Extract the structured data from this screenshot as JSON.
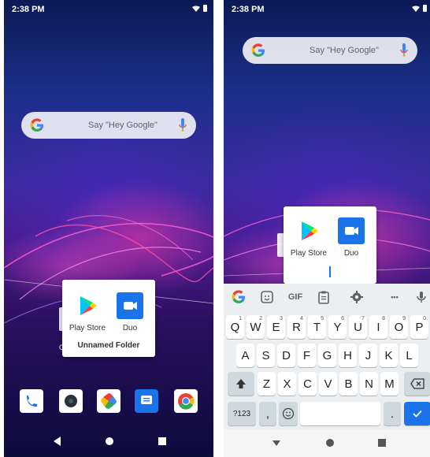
{
  "left_screen": {
    "status_time": "2:38 PM",
    "search_hint": "Say \"Hey Google\"",
    "folder": {
      "apps": [
        {
          "label": "Play Store"
        },
        {
          "label": "Duo"
        }
      ],
      "name": "Unnamed Folder"
    },
    "behind_label": "G",
    "dock_icons": [
      "phone-icon",
      "camera-icon",
      "photos-icon",
      "messages-icon",
      "chrome-icon"
    ]
  },
  "right_screen": {
    "status_time": "2:38 PM",
    "search_hint": "Say \"Hey Google\"",
    "folder": {
      "apps": [
        {
          "label": "Play Store"
        },
        {
          "label": "Duo"
        }
      ]
    },
    "keyboard": {
      "toolbar": {
        "gif_label": "GIF",
        "more_label": "•••"
      },
      "row1": [
        {
          "k": "Q",
          "s": "1"
        },
        {
          "k": "W",
          "s": "2"
        },
        {
          "k": "E",
          "s": "3"
        },
        {
          "k": "R",
          "s": "4"
        },
        {
          "k": "T",
          "s": "5"
        },
        {
          "k": "Y",
          "s": "6"
        },
        {
          "k": "U",
          "s": "7"
        },
        {
          "k": "I",
          "s": "8"
        },
        {
          "k": "O",
          "s": "9"
        },
        {
          "k": "P",
          "s": "0"
        }
      ],
      "row2": [
        "A",
        "S",
        "D",
        "F",
        "G",
        "H",
        "J",
        "K",
        "L"
      ],
      "row3": [
        "Z",
        "X",
        "C",
        "V",
        "B",
        "N",
        "M"
      ],
      "symbols_label": "?123",
      "comma_label": ",",
      "period_label": "."
    }
  },
  "colors": {
    "accent_blue": "#1a73e8",
    "keyboard_bg": "#eceff1"
  }
}
